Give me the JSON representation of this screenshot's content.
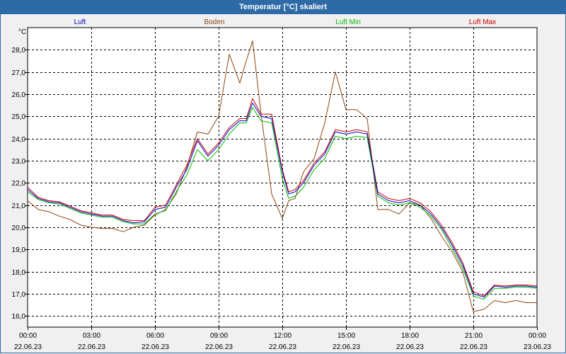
{
  "window": {
    "title": "Temperatur [°C] skaliert"
  },
  "chart_data": {
    "type": "line",
    "title": "Temperatur [°C] skaliert",
    "ylabel": "°C",
    "xlabel": "",
    "ylim": [
      15.5,
      29.0
    ],
    "yticks": [
      16.0,
      17.0,
      18.0,
      19.0,
      20.0,
      21.0,
      22.0,
      23.0,
      24.0,
      25.0,
      26.0,
      27.0,
      28.0
    ],
    "ytick_labels": [
      "16,0",
      "17,0",
      "18,0",
      "19,0",
      "20,0",
      "21,0",
      "22,0",
      "23,0",
      "24,0",
      "25,0",
      "26,0",
      "27,0",
      "28,0"
    ],
    "xlim": [
      0,
      24
    ],
    "xticks": [
      0,
      3,
      6,
      9,
      12,
      15,
      18,
      21,
      24
    ],
    "xtick_time_labels": [
      "00:00",
      "03:00",
      "06:00",
      "09:00",
      "12:00",
      "15:00",
      "18:00",
      "21:00",
      "00:00"
    ],
    "xtick_date_labels": [
      "22.06.23",
      "22.06.23",
      "22.06.23",
      "22.06.23",
      "22.06.23",
      "22.06.23",
      "22.06.23",
      "22.06.23",
      "23.06.23"
    ],
    "grid": true,
    "legend_position": "top",
    "series": [
      {
        "name": "Luft",
        "color": "#0000cc",
        "x": [
          0,
          0.5,
          1,
          1.5,
          2,
          2.5,
          3,
          3.5,
          4,
          4.5,
          5,
          5.5,
          6,
          6.5,
          7,
          7.5,
          8,
          8.5,
          9,
          9.5,
          10,
          10.3,
          10.6,
          11,
          11.5,
          12,
          12.3,
          12.6,
          13,
          13.5,
          14,
          14.5,
          15,
          15.5,
          16,
          16.5,
          17,
          17.5,
          18,
          18.5,
          19,
          19.5,
          20,
          20.5,
          21,
          21.5,
          22,
          22.5,
          23,
          23.5,
          24
        ],
        "values": [
          21.7,
          21.3,
          21.15,
          21.1,
          20.9,
          20.7,
          20.6,
          20.5,
          20.5,
          20.3,
          20.2,
          20.25,
          20.8,
          20.9,
          21.8,
          22.6,
          23.9,
          23.2,
          23.7,
          24.4,
          24.8,
          24.8,
          25.6,
          25.0,
          24.9,
          22.5,
          21.5,
          21.6,
          22.0,
          22.8,
          23.3,
          24.3,
          24.2,
          24.3,
          24.2,
          21.5,
          21.2,
          21.1,
          21.2,
          21.0,
          20.6,
          20.0,
          19.2,
          18.3,
          17.0,
          16.85,
          17.35,
          17.3,
          17.35,
          17.35,
          17.3
        ]
      },
      {
        "name": "Boden",
        "color": "#8b4513",
        "x": [
          0,
          0.5,
          1,
          1.5,
          2,
          2.5,
          3,
          3.5,
          4,
          4.5,
          5,
          5.5,
          6,
          6.5,
          7,
          7.5,
          8,
          8.5,
          9,
          9.5,
          10,
          10.3,
          10.6,
          11,
          11.5,
          12,
          12.3,
          12.6,
          13,
          13.5,
          14,
          14.5,
          15,
          15.5,
          16,
          16.5,
          17,
          17.5,
          18,
          18.5,
          19,
          19.5,
          20,
          20.5,
          21,
          21.5,
          22,
          22.5,
          23,
          23.5,
          24
        ],
        "values": [
          21.2,
          20.8,
          20.7,
          20.5,
          20.35,
          20.1,
          20.0,
          19.95,
          19.95,
          19.8,
          20.0,
          20.1,
          20.55,
          20.8,
          21.5,
          22.7,
          24.3,
          24.2,
          25.0,
          27.8,
          26.5,
          27.5,
          28.4,
          25.1,
          21.5,
          20.4,
          21.2,
          21.3,
          22.5,
          23.1,
          24.7,
          27.0,
          25.3,
          25.3,
          24.9,
          20.8,
          20.8,
          20.6,
          21.1,
          21.0,
          20.4,
          19.6,
          18.9,
          18.0,
          16.2,
          16.3,
          16.7,
          16.6,
          16.7,
          16.6,
          16.6
        ]
      },
      {
        "name": "Luft Min",
        "color": "#00bb00",
        "x": [
          0,
          0.5,
          1,
          1.5,
          2,
          2.5,
          3,
          3.5,
          4,
          4.5,
          5,
          5.5,
          6,
          6.5,
          7,
          7.5,
          8,
          8.5,
          9,
          9.5,
          10,
          10.3,
          10.6,
          11,
          11.5,
          12,
          12.3,
          12.6,
          13,
          13.5,
          14,
          14.5,
          15,
          15.5,
          16,
          16.5,
          17,
          17.5,
          18,
          18.5,
          19,
          19.5,
          20,
          20.5,
          21,
          21.5,
          22,
          22.5,
          23,
          23.5,
          24
        ],
        "values": [
          21.6,
          21.25,
          21.1,
          21.05,
          20.85,
          20.65,
          20.55,
          20.45,
          20.45,
          20.25,
          20.15,
          20.15,
          20.6,
          20.75,
          21.6,
          22.35,
          23.5,
          23.0,
          23.5,
          24.2,
          24.7,
          24.7,
          25.4,
          24.8,
          24.7,
          22.2,
          21.3,
          21.4,
          21.8,
          22.6,
          23.1,
          24.1,
          24.0,
          24.1,
          24.05,
          21.4,
          21.1,
          21.0,
          21.1,
          20.9,
          20.5,
          19.9,
          19.05,
          18.15,
          16.9,
          16.75,
          17.25,
          17.25,
          17.3,
          17.3,
          17.25
        ]
      },
      {
        "name": "Luft Max",
        "color": "#cc0000",
        "x": [
          0,
          0.5,
          1,
          1.5,
          2,
          2.5,
          3,
          3.5,
          4,
          4.5,
          5,
          5.5,
          6,
          6.5,
          7,
          7.5,
          8,
          8.5,
          9,
          9.5,
          10,
          10.3,
          10.6,
          11,
          11.5,
          12,
          12.3,
          12.6,
          13,
          13.5,
          14,
          14.5,
          15,
          15.5,
          16,
          16.5,
          17,
          17.5,
          18,
          18.5,
          19,
          19.5,
          20,
          20.5,
          21,
          21.5,
          22,
          22.5,
          23,
          23.5,
          24
        ],
        "values": [
          21.8,
          21.35,
          21.2,
          21.15,
          20.95,
          20.75,
          20.65,
          20.55,
          20.55,
          20.35,
          20.3,
          20.3,
          20.9,
          21.0,
          21.9,
          22.8,
          24.0,
          23.3,
          23.8,
          24.5,
          24.9,
          24.9,
          25.8,
          25.1,
          25.1,
          22.6,
          21.6,
          21.7,
          22.1,
          22.9,
          23.4,
          24.4,
          24.3,
          24.4,
          24.3,
          21.6,
          21.3,
          21.2,
          21.3,
          21.1,
          20.7,
          20.1,
          19.3,
          18.4,
          17.1,
          16.9,
          17.4,
          17.35,
          17.4,
          17.4,
          17.35
        ]
      }
    ]
  }
}
